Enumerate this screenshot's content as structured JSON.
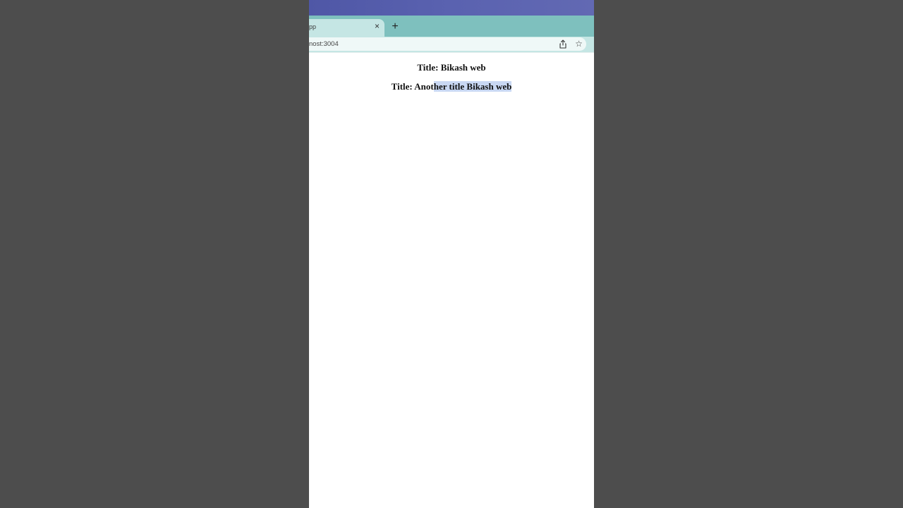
{
  "browser": {
    "tab_title": "pp",
    "tab_close_symbol": "×",
    "new_tab_symbol": "+",
    "url": "nost:3004",
    "star_symbol": "☆"
  },
  "page": {
    "heading_1": "Title: Bikash web",
    "heading_2_unselected": "Title: Anot",
    "heading_2_selected": "her title Bikash web"
  },
  "colors": {
    "outer_background": "#4d4d4d",
    "titlebar": "#5a62b0",
    "tabstrip": "#7ec0be",
    "active_tab": "#c5e6e4",
    "omnibox": "#eff8f7",
    "text_selection": "#c9d8f3"
  }
}
